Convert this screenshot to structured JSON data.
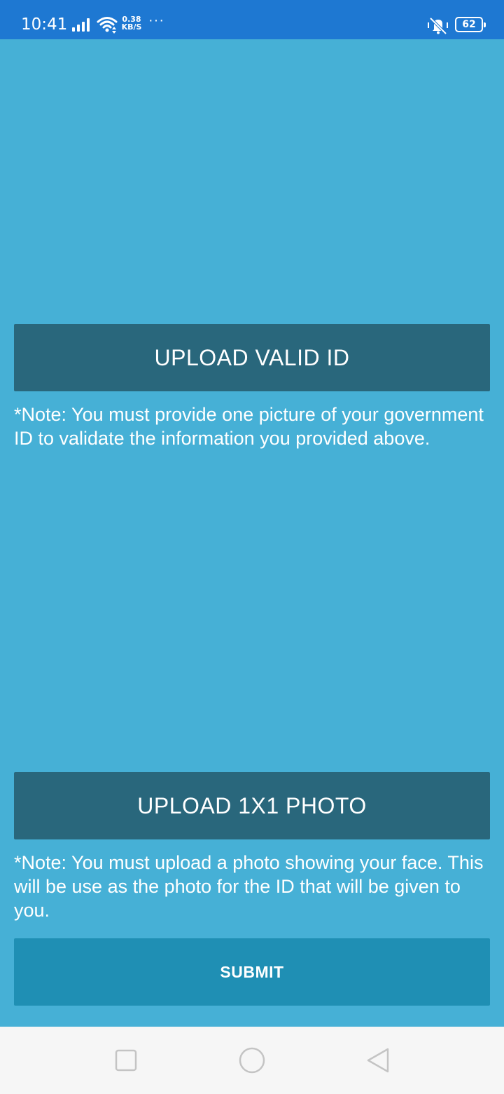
{
  "status_bar": {
    "time": "10:41",
    "net_speed_value": "0.38",
    "net_speed_unit": "KB/S",
    "more": "···",
    "battery": "62",
    "icons": [
      "signal-icon",
      "wifi-icon",
      "mute-icon",
      "battery-icon"
    ]
  },
  "form": {
    "upload_id_label": "UPLOAD VALID ID",
    "upload_id_note": "*Note: You must provide one picture of your government ID to validate the information you provided above.",
    "upload_photo_label": "UPLOAD 1X1 PHOTO",
    "upload_photo_note": "*Note: You must upload a photo showing your face. This will be use as the photo for the ID that will be given to you.",
    "submit_label": "SUBMIT"
  },
  "nav_bar": {
    "icons": [
      "recents-square-icon",
      "home-circle-icon",
      "back-triangle-icon"
    ]
  },
  "colors": {
    "status_bar": "#1e78d2",
    "background": "#46b0d6",
    "upload_button": "#29677c",
    "submit_button": "#1f8fb4",
    "nav_bar": "#f6f6f6"
  }
}
